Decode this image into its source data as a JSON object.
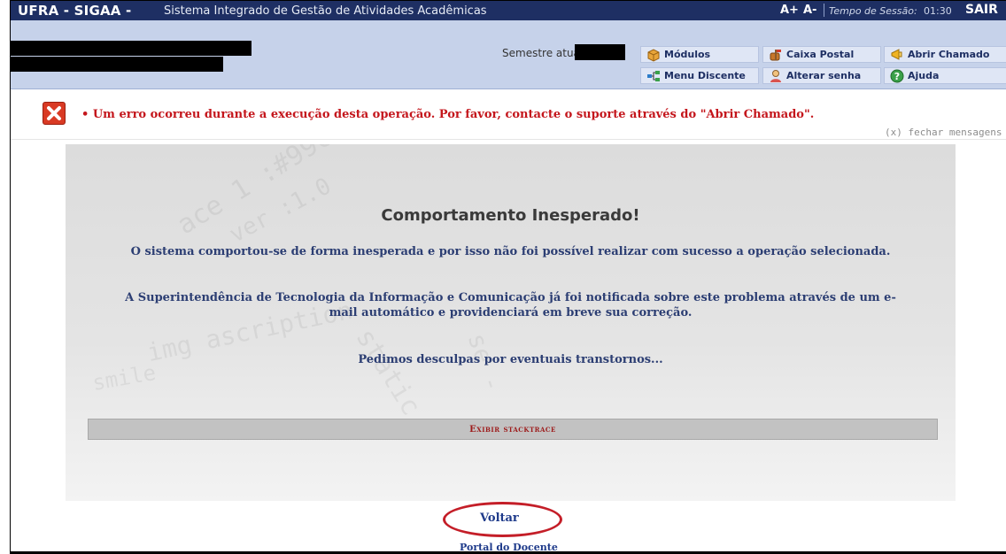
{
  "header": {
    "app_name": "UFRA - SIGAA -",
    "app_desc": "Sistema Integrado de Gestão de Atividades Acadêmicas",
    "font_increase": "A+",
    "font_decrease": "A-",
    "session_label": "Tempo de Sessão:",
    "session_time": "01:30",
    "logout": "SAIR"
  },
  "user_bar": {
    "semester_label": "Semestre atual:",
    "menu": {
      "modulos": "Módulos",
      "caixa_postal": "Caixa Postal",
      "abrir_chamado": "Abrir Chamado",
      "menu_discente": "Menu Discente",
      "alterar_senha": "Alterar senha",
      "ajuda": "Ajuda"
    }
  },
  "messages": {
    "error": "• Um erro ocorreu durante a execução desta operação. Por favor, contacte o suporte através do \"Abrir Chamado\".",
    "close": "(x) fechar mensagens"
  },
  "error_panel": {
    "title": "Comportamento Inesperado!",
    "paragraph1": "O sistema comportou-se de forma inesperada e por isso não foi possível realizar com sucesso a operação selecionada.",
    "paragraph2": "A Superintendência de Tecnologia da Informação e Comunicação já foi notificada sobre este problema através de um e-mail automático e providenciará em breve sua correção.",
    "paragraph3": "Pedimos desculpas por eventuais transtornos...",
    "stacktrace": "Exibir stacktrace"
  },
  "footer": {
    "back": "Voltar",
    "portal": "Portal do Docente"
  },
  "colors": {
    "header_bg": "#1e2f63",
    "infobar_bg": "#c6d2ea",
    "error_text": "#c4161c",
    "highlight_circle": "#c41e28"
  },
  "icons": [
    "modules-box-icon",
    "mailbox-icon",
    "megaphone-icon",
    "menu-network-icon",
    "user-key-icon",
    "help-icon",
    "error-x-icon"
  ]
}
